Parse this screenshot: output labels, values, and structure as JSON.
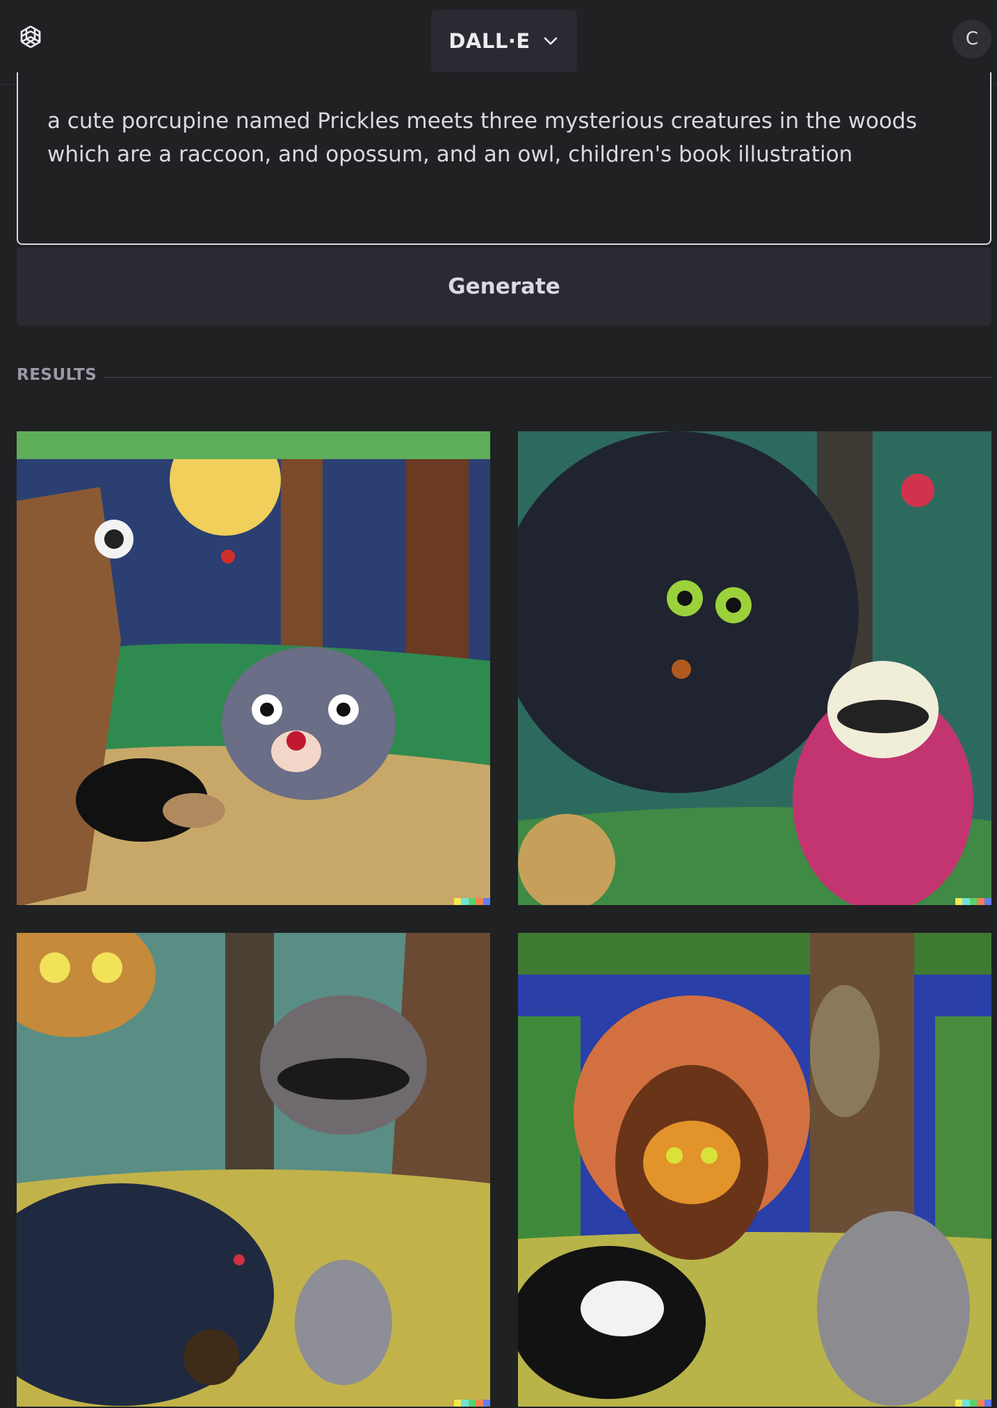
{
  "header": {
    "model_label": "DALL·E",
    "avatar_initial": "C"
  },
  "prompt": {
    "text": "a cute porcupine named Prickles meets three mysterious creatures in the woods which are a raccoon, and opossum, and an owl, children's book illustration"
  },
  "actions": {
    "generate_label": "Generate"
  },
  "results": {
    "heading": "RESULTS",
    "images": [
      {
        "subject": "night forest with moon, fox, hedgehog and grey creature"
      },
      {
        "subject": "dark furry creature with green eyes, raccoon in pink dress, hedgehog"
      },
      {
        "subject": "owl, porcupine, raccoon and opossum in forest"
      },
      {
        "subject": "owl with fan feathers, badger, owl in tree, raccoon"
      }
    ]
  },
  "colors": {
    "background": "#202123",
    "panel": "#2a2b32",
    "text": "#ececf1",
    "muted": "#9a9aa6"
  }
}
